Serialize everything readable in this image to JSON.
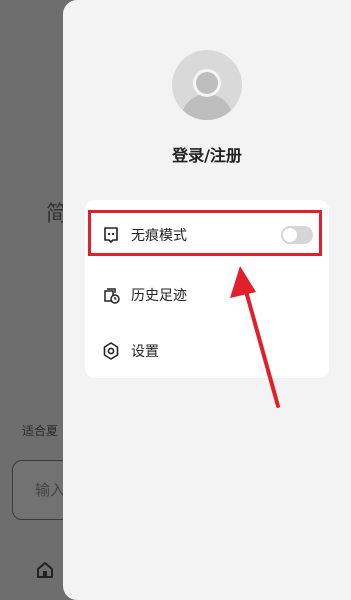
{
  "background": {
    "char": "简",
    "small_text": "适合夏",
    "input_placeholder": "输入"
  },
  "drawer": {
    "login_label": "登录/注册",
    "menu": [
      {
        "label": "无痕模式",
        "icon": "incognito-icon",
        "toggle_on": false
      },
      {
        "label": "历史足迹",
        "icon": "history-icon"
      },
      {
        "label": "设置",
        "icon": "settings-icon"
      }
    ]
  },
  "colors": {
    "highlight": "#e0202a",
    "drawer_bg": "#f3f3f3",
    "overlay": "#6e6e6e"
  }
}
